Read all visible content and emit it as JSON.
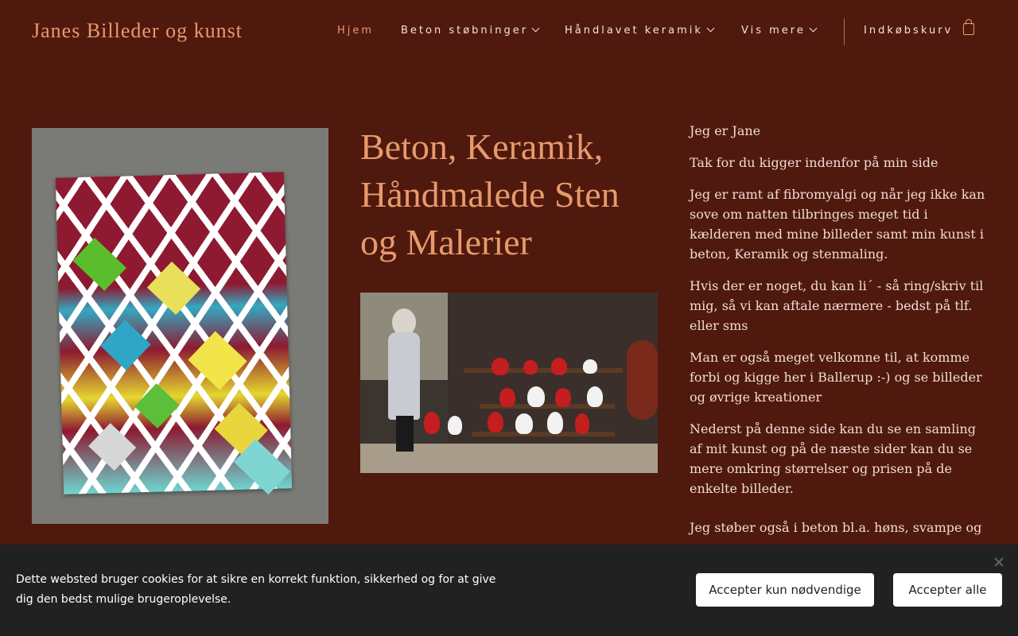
{
  "header": {
    "logo": "Janes Billeder og kunst",
    "nav": [
      {
        "label": "Hjem",
        "active": true,
        "has_dropdown": false
      },
      {
        "label": "Beton støbninger",
        "active": false,
        "has_dropdown": true
      },
      {
        "label": "Håndlavet keramik",
        "active": false,
        "has_dropdown": true
      },
      {
        "label": "Vis mere",
        "active": false,
        "has_dropdown": true
      }
    ],
    "cart_label": "Indkøbskurv",
    "cart_icon": "shopping-bag-icon"
  },
  "main": {
    "title": "Beton, Keramik, Håndmalede Sten og Malerier",
    "paragraphs": [
      "Jeg er Jane",
      "Tak for du kigger indenfor på min side",
      "Jeg er ramt af fibromyalgi og når jeg ikke kan sove om natten tilbringes meget tid i kælderen med mine billeder samt min kunst i beton, Keramik og stenmaling.",
      "Hvis der er noget, du kan li´ - så ring/skriv til mig, så vi kan aftale nærmere - bedst på tlf. eller sms",
      "Man er også meget velkomne til, at komme forbi og kigge her i Ballerup :-) og se billeder og øvrige kreationer",
      "Nederst på denne side kan du se en samling af mit kunst og på de næste sider kan du se mere omkring størrelser og prisen på de enkelte billeder.",
      "Jeg støber også i beton bl.a. høns, svampe og"
    ]
  },
  "cookie": {
    "text": "Dette websted bruger cookies for at sikre en korrekt funktion, sikkerhed og for at give dig den bedst mulige brugeroplevelse.",
    "btn_necessary": "Accepter kun nødvendige",
    "btn_all": "Accepter alle"
  },
  "colors": {
    "background": "#4f190e",
    "accent": "#e79a6c",
    "cookie_bar": "#212121"
  }
}
